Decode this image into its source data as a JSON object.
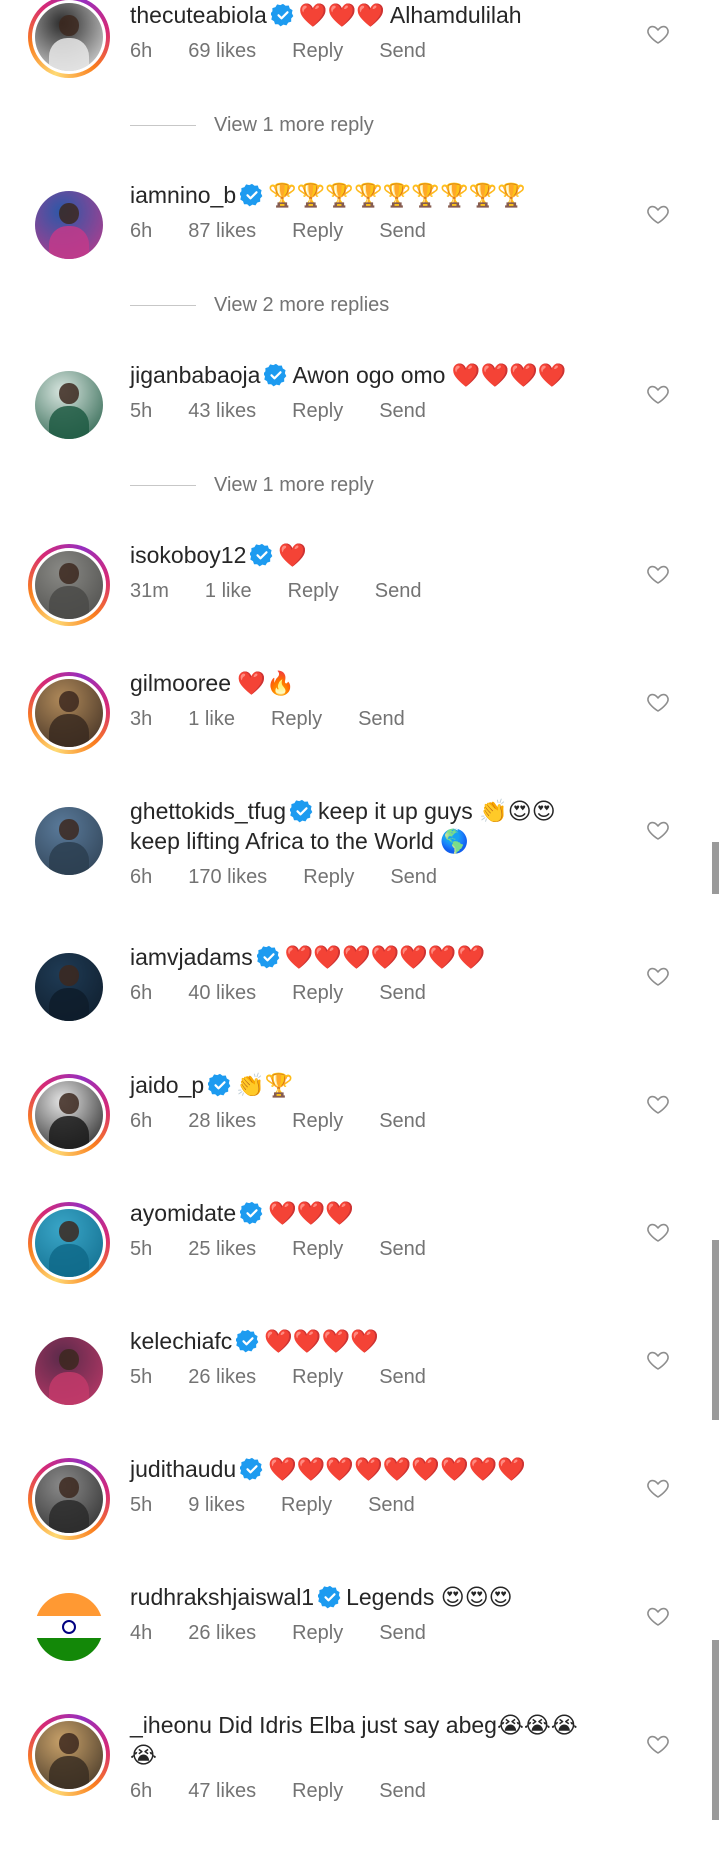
{
  "comments": [
    {
      "username": "thecuteabiola",
      "verified": true,
      "text": "❤️❤️❤️ Alhamdulilah",
      "time": "6h",
      "likes": "69 likes",
      "reply": "Reply",
      "send": "Send",
      "story": true,
      "avatar_colors": [
        "#2b2b2b",
        "#e8e8e8"
      ]
    },
    {
      "username": "iamnino_b",
      "verified": true,
      "text": "🏆🏆🏆🏆🏆🏆🏆🏆🏆",
      "time": "6h",
      "likes": "87 likes",
      "reply": "Reply",
      "send": "Send",
      "story": false,
      "avatar_colors": [
        "#2a58a8",
        "#c23a8a"
      ]
    },
    {
      "username": "jiganbabaoja",
      "verified": true,
      "text": "Awon ogo omo ❤️❤️❤️❤️",
      "time": "5h",
      "likes": "43 likes",
      "reply": "Reply",
      "send": "Send",
      "story": false,
      "avatar_colors": [
        "#d9e6e0",
        "#1f5a43"
      ]
    },
    {
      "username": "isokoboy12",
      "verified": true,
      "text": "❤️",
      "time": "31m",
      "likes": "1 like",
      "reply": "Reply",
      "send": "Send",
      "story": true,
      "avatar_colors": [
        "#8a8a86",
        "#4a4a48"
      ]
    },
    {
      "username": "gilmooree",
      "verified": false,
      "text": "❤️🔥",
      "time": "3h",
      "likes": "1 like",
      "reply": "Reply",
      "send": "Send",
      "story": true,
      "avatar_colors": [
        "#b08a5a",
        "#3a2a20"
      ]
    },
    {
      "username": "ghettokids_tfug",
      "verified": true,
      "text": "keep it up guys 👏😍😍",
      "text2": "keep lifting Africa to the World 🌎",
      "time": "6h",
      "likes": "170 likes",
      "reply": "Reply",
      "send": "Send",
      "story": false,
      "avatar_colors": [
        "#5a7a9a",
        "#2c3e50"
      ]
    },
    {
      "username": "iamvjadams",
      "verified": true,
      "text": "❤️❤️❤️❤️❤️❤️❤️",
      "time": "6h",
      "likes": "40 likes",
      "reply": "Reply",
      "send": "Send",
      "story": false,
      "avatar_colors": [
        "#1f3b55",
        "#0e1c2a"
      ]
    },
    {
      "username": "jaido_p",
      "verified": true,
      "text": "👏🏆",
      "time": "6h",
      "likes": "28 likes",
      "reply": "Reply",
      "send": "Send",
      "story": true,
      "avatar_colors": [
        "#e6e6e6",
        "#1a1a1a"
      ]
    },
    {
      "username": "ayomidate",
      "verified": true,
      "text": "❤️❤️❤️",
      "time": "5h",
      "likes": "25 likes",
      "reply": "Reply",
      "send": "Send",
      "story": true,
      "avatar_colors": [
        "#3aa6c8",
        "#0f6a8a"
      ]
    },
    {
      "username": "kelechiafc",
      "verified": true,
      "text": "❤️❤️❤️❤️",
      "time": "5h",
      "likes": "26 likes",
      "reply": "Reply",
      "send": "Send",
      "story": false,
      "avatar_colors": [
        "#5a2a4a",
        "#c23a6a"
      ]
    },
    {
      "username": "judithaudu",
      "verified": true,
      "text": "❤️❤️❤️❤️❤️❤️❤️❤️❤️",
      "time": "5h",
      "likes": "9 likes",
      "reply": "Reply",
      "send": "Send",
      "story": true,
      "avatar_colors": [
        "#8a8a8a",
        "#2a2a2a"
      ]
    },
    {
      "username": "rudhrakshjaiswal1",
      "verified": true,
      "text": "Legends 😍😍😍",
      "time": "4h",
      "likes": "26 likes",
      "reply": "Reply",
      "send": "Send",
      "story": false,
      "flag": true,
      "avatar_colors": [
        "#ff9933",
        "#138808"
      ]
    },
    {
      "username": "_iheonu",
      "verified": false,
      "text": "Did Idris Elba just say abeg😭😭😭",
      "text2": "😭",
      "time": "6h",
      "likes": "47 likes",
      "reply": "Reply",
      "send": "Send",
      "story": true,
      "avatar_colors": [
        "#c9a26a",
        "#3a2e22"
      ]
    }
  ],
  "view_replies": [
    {
      "label": "View 1 more reply"
    },
    {
      "label": "View 2 more replies"
    },
    {
      "label": "View 1 more reply"
    }
  ],
  "colors": {
    "heart_red": "#e0233b",
    "verified_blue": "#1d9bf0",
    "meta_gray": "#737373"
  },
  "icons": {
    "like": "heart-outline-icon",
    "verified": "verified-badge-icon"
  }
}
